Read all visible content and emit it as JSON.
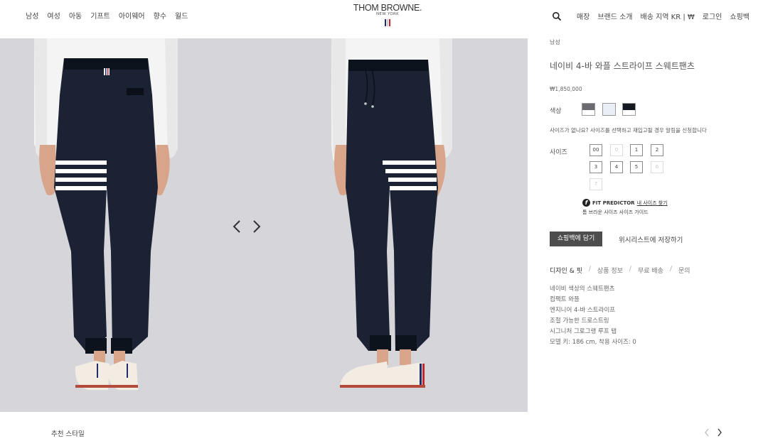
{
  "header": {
    "nav_left": [
      "남성",
      "여성",
      "아동",
      "기프트",
      "아이웨어",
      "향수",
      "월드"
    ],
    "logo_main": "THOM BROWNE.",
    "logo_sub": "NEW YORK",
    "nav_right": [
      "매장",
      "브랜드 소개",
      "배송 지역 KR | ₩",
      "로그인",
      "쇼핑백"
    ],
    "search_icon": "search-icon",
    "flag_colors": [
      "#1f2c6b",
      "#ffffff",
      "#c0272d"
    ]
  },
  "product": {
    "breadcrumb": "남성",
    "title": "네이비 4-바 와플 스트라이프 스웨트팬츠",
    "price": "₩1,850,000",
    "color_label": "색상",
    "swatches": [
      "#6a6a70",
      "#e9eef7",
      "#141821"
    ],
    "size_note": "사이즈가 없나요? 사이즈를 선택하고 재입고될 경우 알림을 신청합니다",
    "size_label": "사이즈",
    "sizes": [
      {
        "label": "00",
        "available": true
      },
      {
        "label": "0",
        "available": false
      },
      {
        "label": "1",
        "available": true
      },
      {
        "label": "2",
        "available": true
      },
      {
        "label": "3",
        "available": true
      },
      {
        "label": "4",
        "available": true
      },
      {
        "label": "5",
        "available": true
      },
      {
        "label": "6",
        "available": false
      },
      {
        "label": "7",
        "available": false
      }
    ],
    "fit_predictor": "FIT PREDICTOR",
    "fit_link": "내 사이즈 찾기",
    "size_guide": "톰 브라운 사이즈 사이즈 가이드",
    "add_to_bag": "쇼핑백에 담기",
    "wishlist": "위시리스트에 저장하기",
    "tabs": [
      "디자인 & 핏",
      "상품 정보",
      "무료 배송",
      "문의"
    ],
    "tab_separator": "/",
    "description": [
      "네이비 색상의 스웨트팬츠",
      "컴팩트 와플",
      "엔지니어 4-바 스트라이프",
      "조절 가능한 드로스트링",
      "시그니처 그로그랭 루프 탭",
      "모델 키: 186 cm, 착용 사이즈: 0"
    ]
  },
  "gallery": {
    "background": "#d6d6da",
    "pants_color": "#1a2233",
    "shirt_color": "#f4f4f4",
    "prev_icon": "chevron-left-icon",
    "next_icon": "chevron-right-icon"
  },
  "bottom": {
    "recommend_title": "추천 스타일"
  }
}
